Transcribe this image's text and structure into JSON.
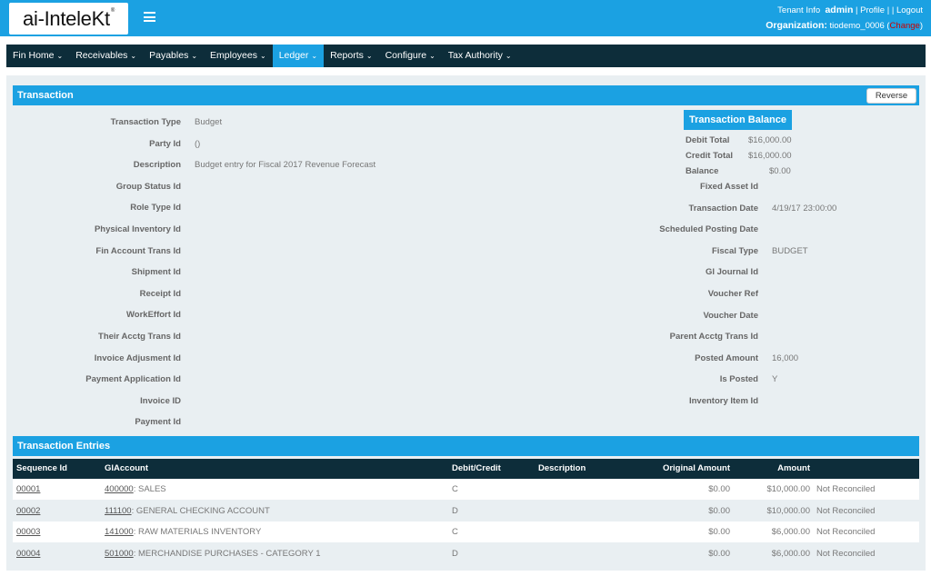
{
  "header": {
    "logo_text": "ai-IntelеKt",
    "logo_mark": "®",
    "tenant_info": "Tenant Info",
    "user": "admin",
    "profile": "Profile",
    "logout": "Logout",
    "organization_label": "Organization:",
    "organization_value": "tiodemo_0006",
    "change": "Change"
  },
  "nav": {
    "items": [
      {
        "label": "Fin Home"
      },
      {
        "label": "Receivables"
      },
      {
        "label": "Payables"
      },
      {
        "label": "Employees"
      },
      {
        "label": "Ledger"
      },
      {
        "label": "Reports"
      },
      {
        "label": "Configure"
      },
      {
        "label": "Tax Authority"
      }
    ],
    "active": "Ledger"
  },
  "transaction": {
    "title": "Transaction",
    "reverse_button": "Reverse",
    "left_fields": [
      {
        "label": "Transaction Type",
        "value": "Budget"
      },
      {
        "label": "Party Id",
        "value": "()"
      },
      {
        "label": "Description",
        "value": "Budget entry for Fiscal 2017 Revenue Forecast"
      },
      {
        "label": "Group Status Id",
        "value": ""
      },
      {
        "label": "Role Type Id",
        "value": ""
      },
      {
        "label": "Physical Inventory Id",
        "value": ""
      },
      {
        "label": "Fin Account Trans Id",
        "value": ""
      },
      {
        "label": "Shipment Id",
        "value": ""
      },
      {
        "label": "Receipt Id",
        "value": ""
      },
      {
        "label": "WorkEffort Id",
        "value": ""
      },
      {
        "label": "Their Acctg Trans Id",
        "value": ""
      },
      {
        "label": "Invoice Adjusment Id",
        "value": ""
      },
      {
        "label": "Payment Application Id",
        "value": ""
      },
      {
        "label": "Invoice ID",
        "value": ""
      },
      {
        "label": "Payment Id",
        "value": ""
      }
    ],
    "balance": {
      "title": "Transaction Balance",
      "debit_label": "Debit Total",
      "debit_value": "$16,000.00",
      "credit_label": "Credit Total",
      "credit_value": "$16,000.00",
      "balance_label": "Balance",
      "balance_value": "$0.00"
    },
    "right_fields": [
      {
        "label": "Fixed Asset Id",
        "value": ""
      },
      {
        "label": "Transaction Date",
        "value": "4/19/17 23:00:00"
      },
      {
        "label": "Scheduled Posting Date",
        "value": ""
      },
      {
        "label": "Fiscal Type",
        "value": "BUDGET"
      },
      {
        "label": "Gl Journal Id",
        "value": ""
      },
      {
        "label": "Voucher Ref",
        "value": ""
      },
      {
        "label": "Voucher Date",
        "value": ""
      },
      {
        "label": "Parent Acctg Trans Id",
        "value": ""
      },
      {
        "label": "Posted Amount",
        "value": "16,000"
      },
      {
        "label": "Is Posted",
        "value": "Y"
      },
      {
        "label": "Inventory Item Id",
        "value": ""
      }
    ]
  },
  "entries": {
    "title": "Transaction Entries",
    "columns": [
      "Sequence Id",
      "GlAccount",
      "Debit/Credit",
      "Description",
      "Original Amount",
      "Amount"
    ],
    "rows": [
      {
        "seq": "00001",
        "acct_code": "400000",
        "acct_name": ": SALES",
        "dc": "C",
        "description": "",
        "original": "$0.00",
        "amount": "$10,000.00",
        "status": "Not Reconciled"
      },
      {
        "seq": "00002",
        "acct_code": "111100",
        "acct_name": ": GENERAL CHECKING ACCOUNT",
        "dc": "D",
        "description": "",
        "original": "$0.00",
        "amount": "$10,000.00",
        "status": "Not Reconciled"
      },
      {
        "seq": "00003",
        "acct_code": "141000",
        "acct_name": ": RAW MATERIALS INVENTORY",
        "dc": "C",
        "description": "",
        "original": "$0.00",
        "amount": "$6,000.00",
        "status": "Not Reconciled"
      },
      {
        "seq": "00004",
        "acct_code": "501000",
        "acct_name": ": MERCHANDISE PURCHASES - CATEGORY 1",
        "dc": "D",
        "description": "",
        "original": "$0.00",
        "amount": "$6,000.00",
        "status": "Not Reconciled"
      }
    ]
  },
  "colors": {
    "accent": "#1ba1e2",
    "nav_bg": "#0d2d3a",
    "panel_bg": "#e9eff2",
    "change_link": "#cc0000"
  }
}
